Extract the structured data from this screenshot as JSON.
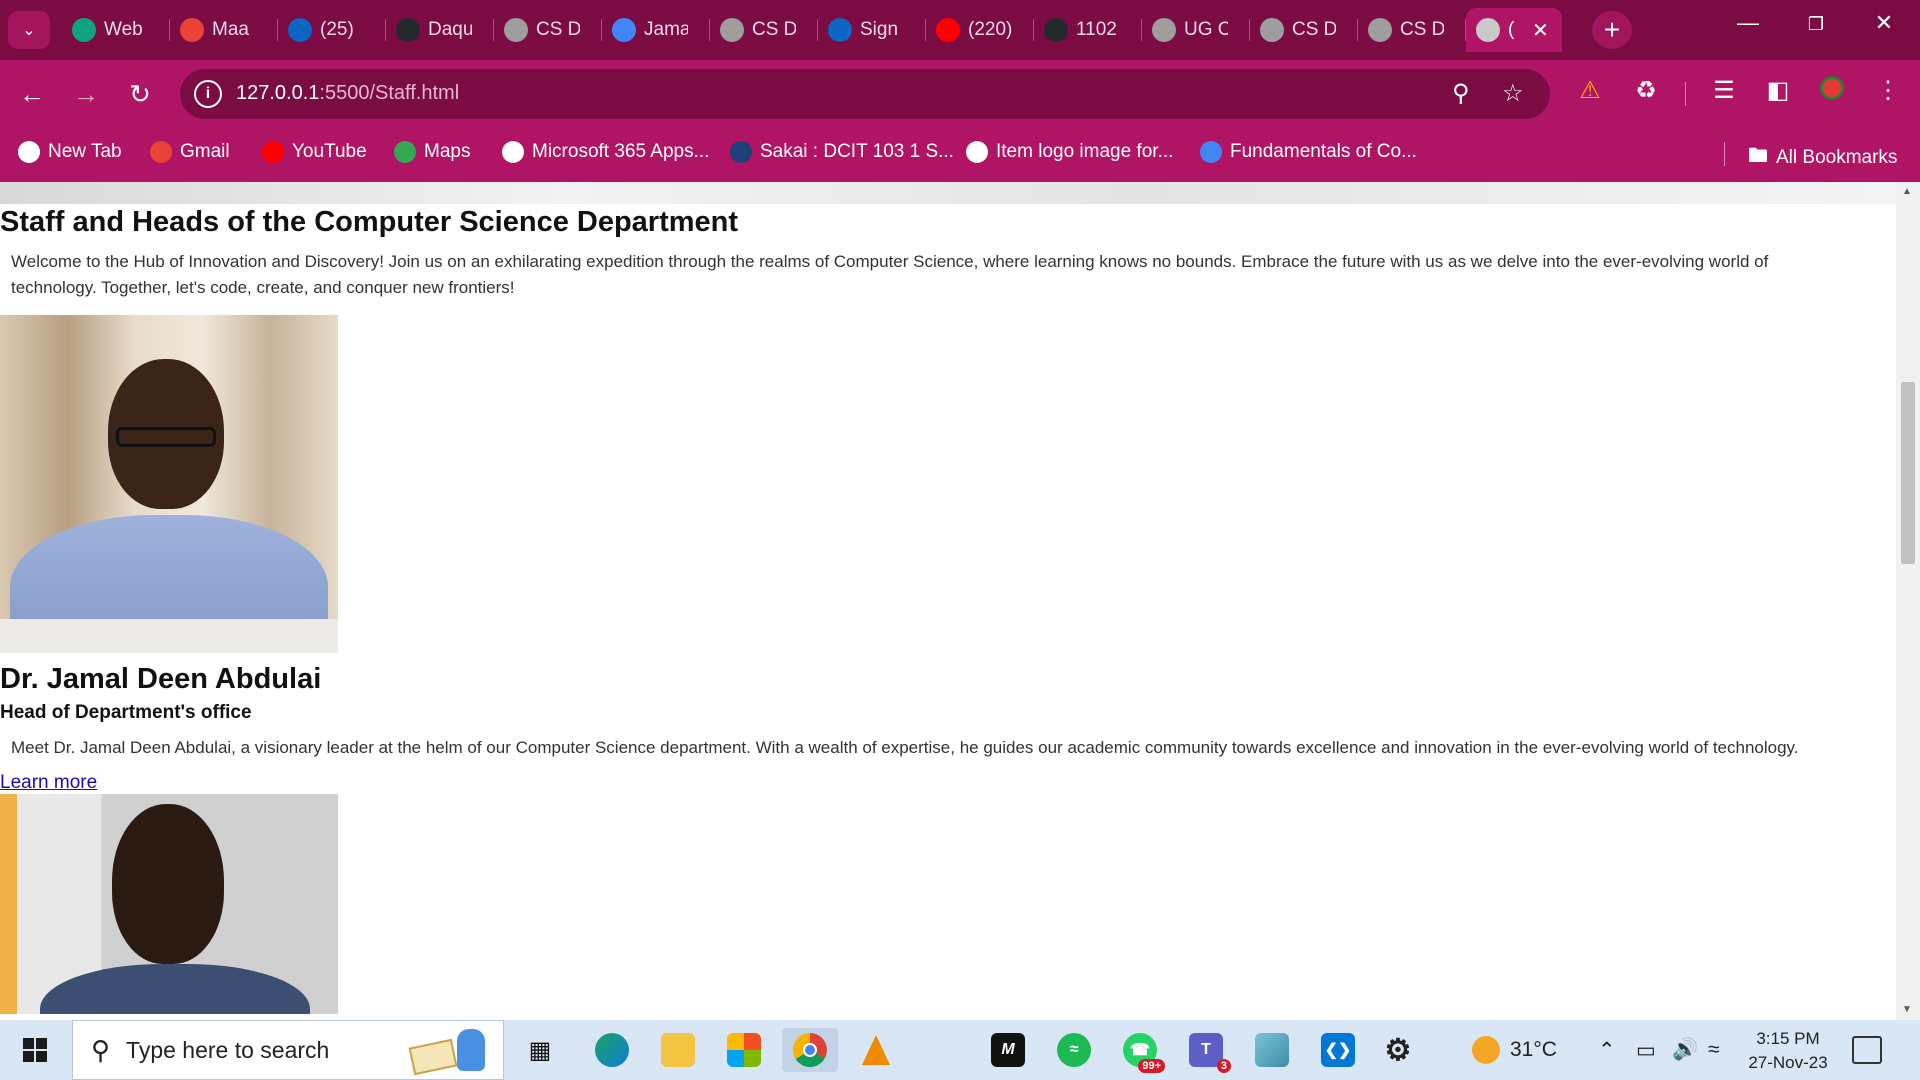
{
  "browser": {
    "tabs": [
      {
        "title": "Web",
        "icon": "chatgpt-icon",
        "color": "#10a37f"
      },
      {
        "title": "Maa",
        "icon": "gmail-icon",
        "color": "#ea4335"
      },
      {
        "title": "(25)",
        "icon": "linkedin-icon",
        "color": "#0a66c2"
      },
      {
        "title": "Daqu",
        "icon": "github-icon",
        "color": "#24292e"
      },
      {
        "title": "CS D",
        "icon": "globe-icon",
        "color": "#9e9e9e"
      },
      {
        "title": "Jama",
        "icon": "google-icon",
        "color": "#4285f4"
      },
      {
        "title": "CS D",
        "icon": "globe-icon",
        "color": "#9e9e9e"
      },
      {
        "title": "Sign",
        "icon": "linkedin-icon",
        "color": "#0a66c2"
      },
      {
        "title": "(220)",
        "icon": "youtube-icon",
        "color": "#ff0000"
      },
      {
        "title": "1102",
        "icon": "github-icon",
        "color": "#24292e"
      },
      {
        "title": "UG C",
        "icon": "globe-icon",
        "color": "#9e9e9e"
      },
      {
        "title": "CS D",
        "icon": "globe-icon",
        "color": "#9e9e9e"
      },
      {
        "title": "CS D",
        "icon": "globe-icon",
        "color": "#9e9e9e"
      }
    ],
    "active_tab": {
      "title": "(",
      "icon": "globe-icon"
    },
    "url_host": "127.0.0.1",
    "url_path": ":5500/Staff.html",
    "bookmarks": [
      {
        "label": "New Tab",
        "icon": "globe-icon",
        "color": "#ffffff"
      },
      {
        "label": "Gmail",
        "icon": "gmail-icon",
        "color": "#ea4335"
      },
      {
        "label": "YouTube",
        "icon": "youtube-icon",
        "color": "#ff0000"
      },
      {
        "label": "Maps",
        "icon": "maps-icon",
        "color": "#34a853"
      },
      {
        "label": "Microsoft 365 Apps...",
        "icon": "globe-icon",
        "color": "#ffffff"
      },
      {
        "label": "Sakai : DCIT 103 1 S...",
        "icon": "sakai-icon",
        "color": "#1f3f7a"
      },
      {
        "label": "Item logo image for...",
        "icon": "globe-icon",
        "color": "#ffffff"
      },
      {
        "label": "Fundamentals of Co...",
        "icon": "google-icon",
        "color": "#4285f4"
      }
    ],
    "all_bookmarks": "All Bookmarks",
    "colors": {
      "frame": "#7a0c43",
      "toolbar": "#b01464"
    }
  },
  "page": {
    "title": "Staff and Heads of the Computer Science Department",
    "intro": "Welcome to the Hub of Innovation and Discovery! Join us on an exhilarating expedition through the realms of Computer Science, where learning knows no bounds. Embrace the future with us as we delve into the ever-evolving world of technology. Together, let's code, create, and conquer new frontiers!",
    "staff": [
      {
        "name": "Dr. Jamal Deen Abdulai",
        "role": "Head of Department's office",
        "description": "Meet Dr. Jamal Deen Abdulai, a visionary leader at the helm of our Computer Science department. With a wealth of expertise, he guides our academic community towards excellence and innovation in the ever-evolving world of technology.",
        "link": "Learn more"
      }
    ]
  },
  "taskbar": {
    "search_placeholder": "Type here to search",
    "weather": "31°C",
    "time": "3:15 PM",
    "date": "27-Nov-23",
    "whatsapp_badge": "99+",
    "teams_badge": "3"
  }
}
